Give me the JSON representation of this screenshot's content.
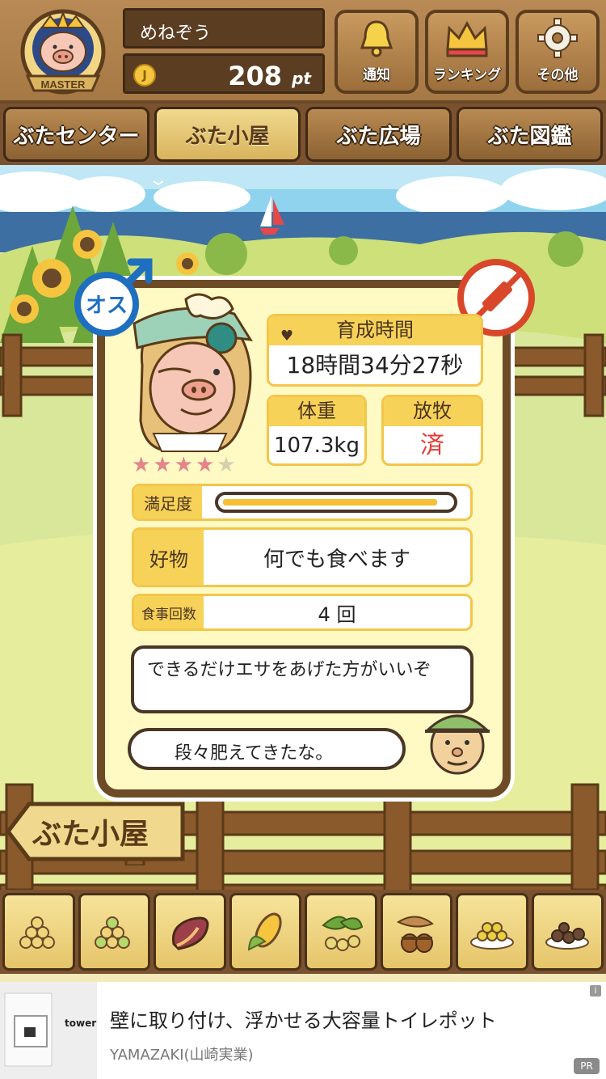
{
  "header": {
    "badge_label": "MASTER",
    "username": "めねぞう",
    "coin_symbol": "J",
    "points": "208",
    "points_unit": "pt",
    "buttons": [
      {
        "label": "通知",
        "icon": "bell-icon"
      },
      {
        "label": "ランキング",
        "icon": "crown-icon"
      },
      {
        "label": "その他",
        "icon": "gear-icon"
      }
    ]
  },
  "tabs": [
    {
      "label": "ぶたセンター",
      "active": false
    },
    {
      "label": "ぶた小屋",
      "active": true
    },
    {
      "label": "ぶた広場",
      "active": false
    },
    {
      "label": "ぶた図鑑",
      "active": false
    }
  ],
  "pig": {
    "gender_label": "オス",
    "rating": 4,
    "rating_max": 5,
    "growth_time_label": "育成時間",
    "growth_time": "18時間34分27秒",
    "weight_label": "体重",
    "weight": "107.3kg",
    "grazing_label": "放牧",
    "grazing": "済",
    "satisfaction_label": "満足度",
    "satisfaction": 0.95,
    "favorite_label": "好物",
    "favorite": "何でも食べます",
    "meals_label": "食事回数",
    "meals": "4 回"
  },
  "dialog": {
    "advice": "できるだけエサをあげた方がいいぞ",
    "comment": "段々肥えてきたな。"
  },
  "place_sign": "ぶた小屋",
  "feeds": [
    "grain-feed-icon",
    "mixed-grain-icon",
    "sweet-potato-icon",
    "corn-icon",
    "soybean-icon",
    "acorn-icon",
    "grain-plate-icon",
    "meatball-plate-icon"
  ],
  "ad": {
    "title": "壁に取り付け、浮かせる大容量トイレポット",
    "advertiser": "YAMAZAKI(山崎実業)",
    "brand": "tower",
    "info": "i",
    "pr": "PR"
  },
  "colors": {
    "wood": "#a67944",
    "panel": "#fff9c4",
    "label_yellow": "#f7d258",
    "accent_red": "#e53935",
    "male_blue": "#1e6fc0"
  }
}
